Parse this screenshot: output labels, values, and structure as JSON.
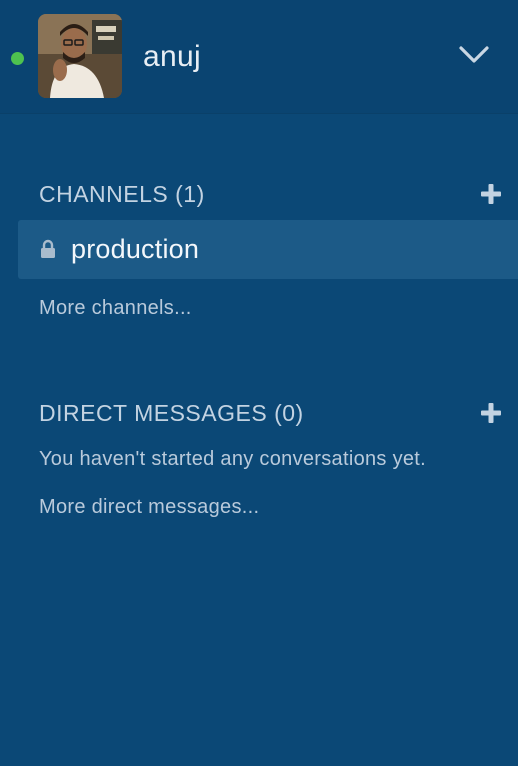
{
  "user": {
    "name": "anuj",
    "status": "online",
    "status_color": "#4ec24f"
  },
  "header": {
    "menu_icon": "chevron-down-icon"
  },
  "channels": {
    "title": "CHANNELS (1)",
    "items": [
      {
        "label": "production",
        "icon": "lock-icon",
        "active": true
      }
    ],
    "more_label": "More channels..."
  },
  "direct_messages": {
    "title": "DIRECT MESSAGES (0)",
    "empty_text": "You haven't started any conversations yet.",
    "more_label": "More direct messages..."
  },
  "colors": {
    "sidebar_bg": "#0b4876",
    "active_row_bg": "#1c5a87",
    "text_primary": "#f3f7fb",
    "text_secondary": "#b9cadb"
  }
}
